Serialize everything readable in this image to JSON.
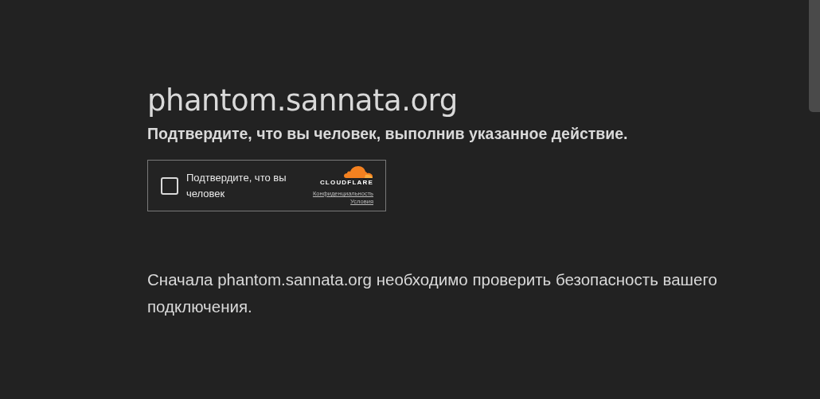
{
  "site": {
    "title": "phantom.sannata.org",
    "subtitle": "Подтвердите, что вы человек, выполнив указанное действие."
  },
  "widget": {
    "checkbox": {
      "label": "Подтвердите, что вы человек",
      "checked": false
    },
    "brand": "CLOUDFLARE",
    "links": [
      "Конфиденциальность",
      "Условия"
    ]
  },
  "message": "Сначала phantom.sannata.org необходимо проверить безопасность вашего подключения."
}
